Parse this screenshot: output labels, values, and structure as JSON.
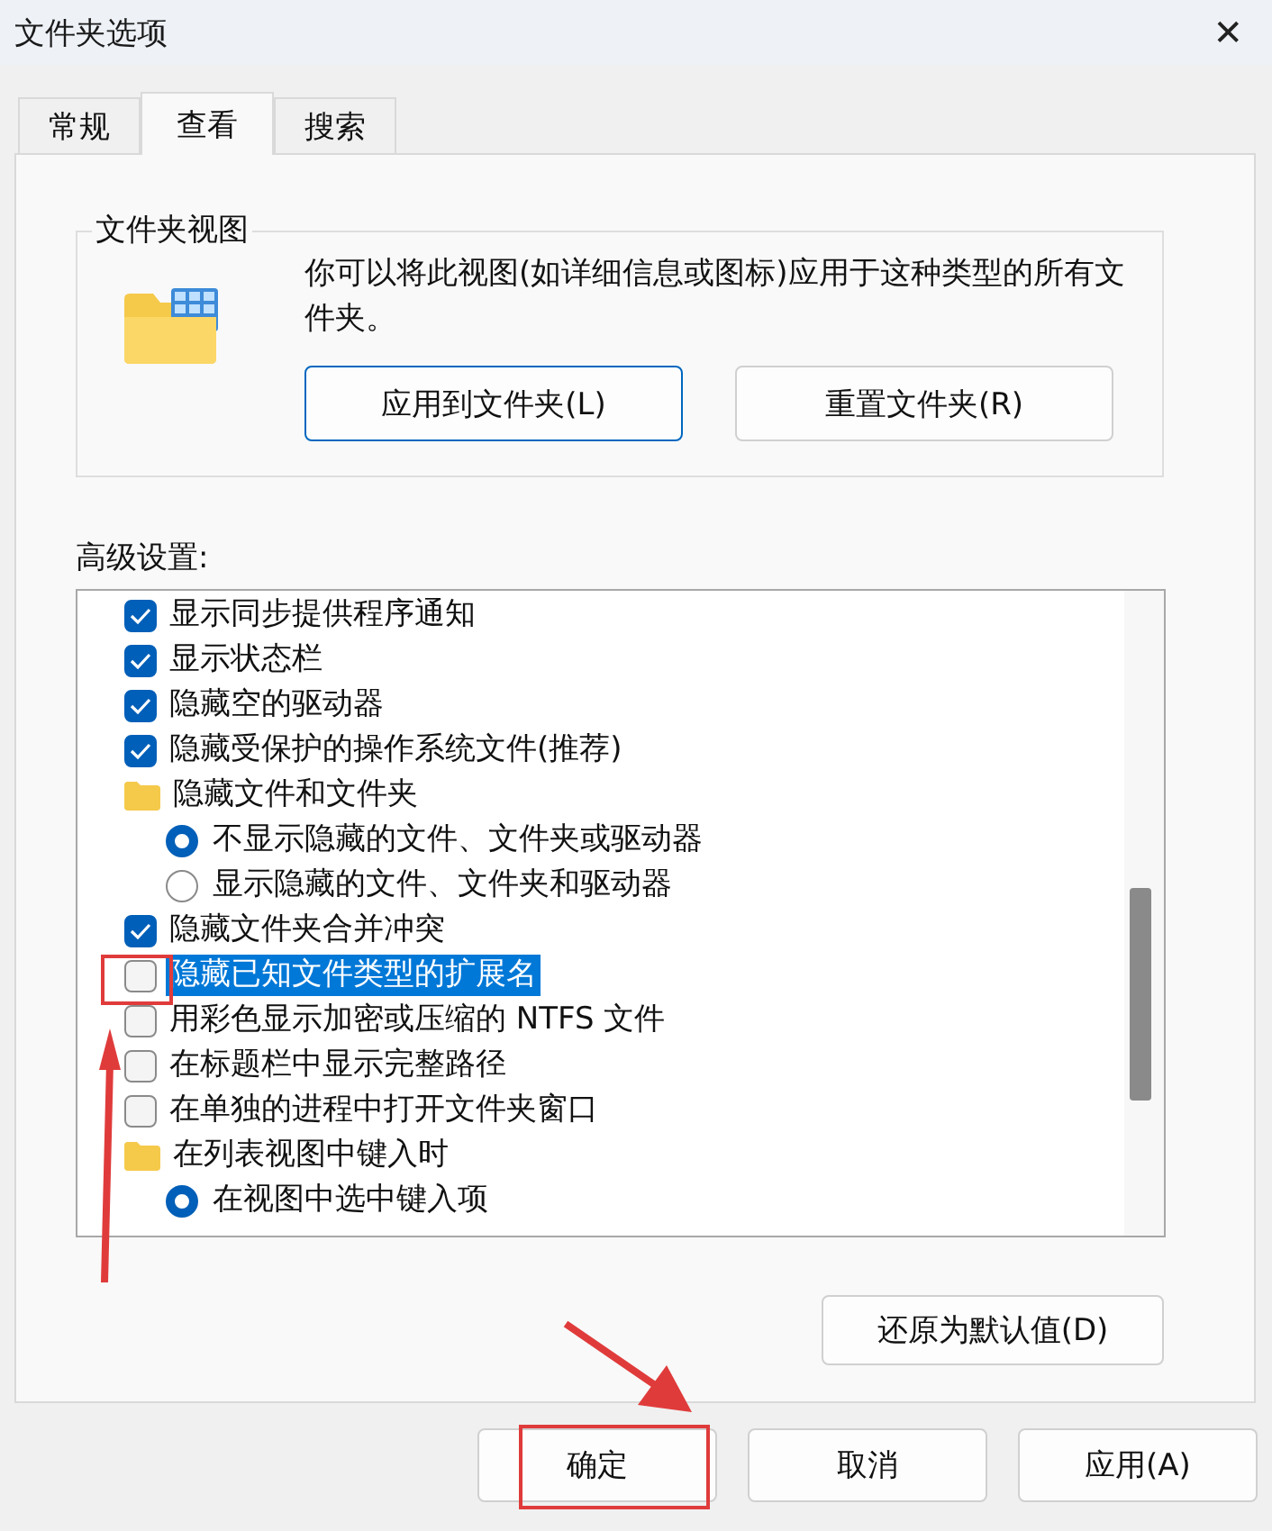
{
  "window": {
    "title": "文件夹选项",
    "close": "✕"
  },
  "tabs": [
    {
      "label": "常规",
      "selected": false
    },
    {
      "label": "查看",
      "selected": true
    },
    {
      "label": "搜索",
      "selected": false
    }
  ],
  "folder_views": {
    "title": "文件夹视图",
    "description": "你可以将此视图(如详细信息或图标)应用于这种类型的所有文件夹。",
    "buttons": [
      {
        "label": "应用到文件夹(L)",
        "default": true
      },
      {
        "label": "重置文件夹(R)",
        "default": false
      }
    ]
  },
  "advanced": {
    "label": "高级设置:",
    "items": [
      {
        "kind": "checkbox",
        "label": "显示同步提供程序通知",
        "checked": true,
        "selected": false,
        "marked": false
      },
      {
        "kind": "checkbox",
        "label": "显示状态栏",
        "checked": true,
        "selected": false,
        "marked": false
      },
      {
        "kind": "checkbox",
        "label": "隐藏空的驱动器",
        "checked": true,
        "selected": false,
        "marked": false
      },
      {
        "kind": "checkbox",
        "label": "隐藏受保护的操作系统文件(推荐)",
        "checked": true,
        "selected": false,
        "marked": false
      },
      {
        "kind": "folder",
        "label": "隐藏文件和文件夹",
        "children": [
          {
            "kind": "radio",
            "label": "不显示隐藏的文件、文件夹或驱动器",
            "checked": true
          },
          {
            "kind": "radio",
            "label": "显示隐藏的文件、文件夹和驱动器",
            "checked": false
          }
        ]
      },
      {
        "kind": "checkbox",
        "label": "隐藏文件夹合并冲突",
        "checked": true,
        "selected": false,
        "marked": false
      },
      {
        "kind": "checkbox",
        "label": "隐藏已知文件类型的扩展名",
        "checked": false,
        "selected": true,
        "marked": true
      },
      {
        "kind": "checkbox",
        "label": "用彩色显示加密或压缩的 NTFS 文件",
        "checked": false,
        "selected": false,
        "marked": false
      },
      {
        "kind": "checkbox",
        "label": "在标题栏中显示完整路径",
        "checked": false,
        "selected": false,
        "marked": false
      },
      {
        "kind": "checkbox",
        "label": "在单独的进程中打开文件夹窗口",
        "checked": false,
        "selected": false,
        "marked": false
      },
      {
        "kind": "folder",
        "label": "在列表视图中键入时",
        "children": [
          {
            "kind": "radio",
            "label": "在视图中选中键入项",
            "checked": true
          }
        ]
      }
    ],
    "reset": "还原为默认值(D)"
  },
  "buttons": [
    {
      "label": "确定",
      "marked": true
    },
    {
      "label": "取消",
      "marked": false
    },
    {
      "label": "应用(A)",
      "marked": false
    }
  ]
}
